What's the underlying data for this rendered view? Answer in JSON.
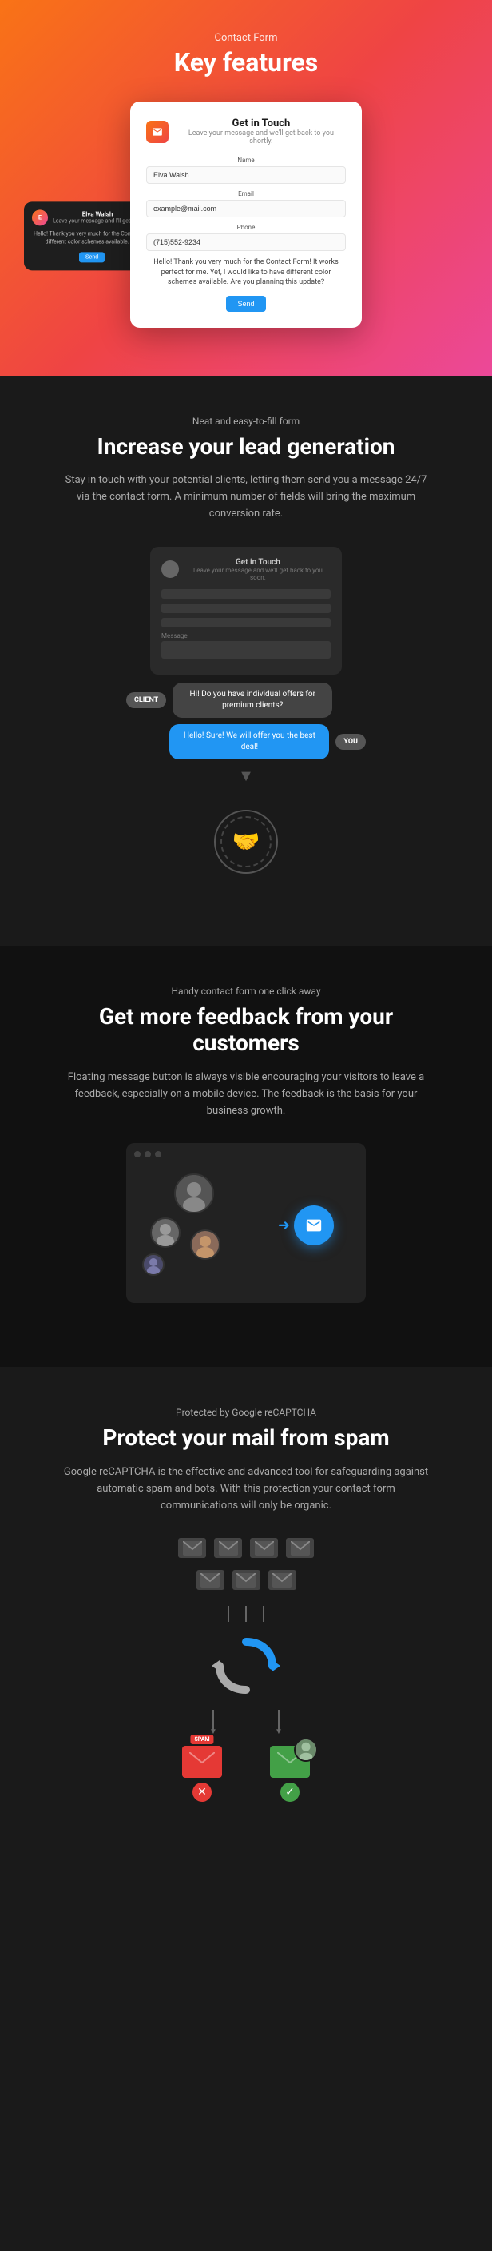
{
  "hero": {
    "subtitle": "Contact Form",
    "title": "Key features",
    "card": {
      "icon": "✉",
      "title": "Get in Touch",
      "description": "Leave your message and we'll get back to you shortly.",
      "name_label": "Name",
      "name_value": "Elva Walsh",
      "email_label": "Email",
      "email_value": "example@mail.com",
      "phone_label": "Phone",
      "phone_value": "(715)552-9234",
      "message": "Hello! Thank you very much for the Contact Form! It works perfect for me. Yet, I would like to have different color schemes available. Are you planning this update?",
      "send_btn": "Send"
    },
    "chat_overlay": {
      "name": "Elva Walsh",
      "subtitle": "Leave your message and I'll get ba...",
      "message": "Hello! Thank you very much for the Cont... have different color schemes available. A...",
      "send_btn": "Send"
    }
  },
  "section1": {
    "subtitle": "Neat and easy-to-fill form",
    "title": "Increase your lead generation",
    "description": "Stay in touch with your potential clients, letting them send you a message 24/7 via the contact form. A minimum number of fields will bring the maximum conversion rate.",
    "form": {
      "icon_label": "Get in Touch",
      "icon_sublabel": "Leave your message and we'll get back to you soon."
    },
    "chat": {
      "client_label": "CLIENT",
      "client_message": "Hi! Do you have individual offers for premium clients?",
      "you_label": "YOU",
      "you_message": "Hello! Sure! We will offer you the best deal!"
    },
    "arrow_down": "▼"
  },
  "section2": {
    "subtitle": "Handy contact form one click away",
    "title": "Get more feedback from your customers",
    "description": "Floating message button is always visible encouraging your visitors to leave a feedback, especially on a mobile device. The feedback is the basis for your business growth.",
    "float_btn": "✉"
  },
  "section3": {
    "subtitle": "Protected by Google reCAPTCHA",
    "title": "Protect your mail from spam",
    "description": "Google reCAPTCHA is the effective and advanced tool for safeguarding against automatic spam and bots. With this protection your contact form communications will only be organic.",
    "spam_label": "SPAM",
    "ok_label": "✓",
    "no_label": "✕"
  }
}
